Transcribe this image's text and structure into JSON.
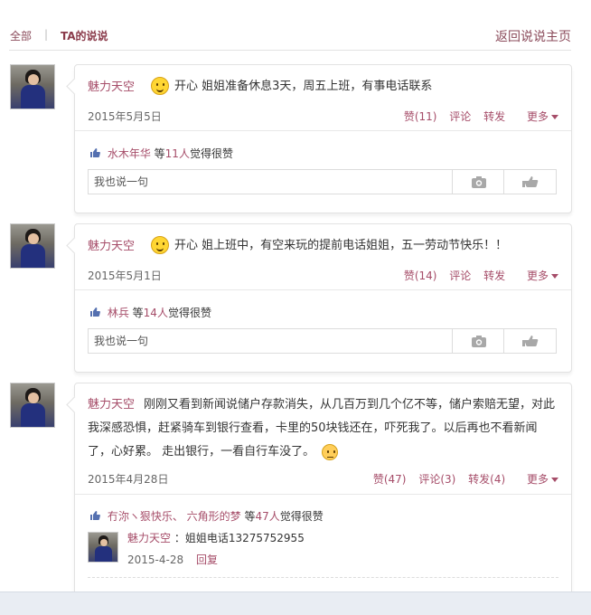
{
  "nav": {
    "all": "全部",
    "separator": "|",
    "current": "TA的说说",
    "back": "返回说说主页"
  },
  "posts": [
    {
      "author": "魅力天空",
      "mood_icon": "smile-emoji",
      "text": "开心 姐姐准备休息3天，周五上班，有事电话联系",
      "date": "2015年5月5日",
      "like_label": "赞(11)",
      "comment_label": "评论",
      "share_label": "转发",
      "more_label": "更多",
      "likers": "水木年华",
      "likes_prefix": " 等",
      "likes_count": "11人",
      "likes_suffix": "觉得很赞",
      "reply_placeholder": "我也说一句"
    },
    {
      "author": "魅力天空",
      "mood_icon": "smile-emoji",
      "text": "开心 姐上班中，有空来玩的提前电话姐姐，五一劳动节快乐！！",
      "date": "2015年5月1日",
      "like_label": "赞(14)",
      "comment_label": "评论",
      "share_label": "转发",
      "more_label": "更多",
      "likers": "林兵",
      "likes_prefix": " 等",
      "likes_count": "14人",
      "likes_suffix": "觉得很赞",
      "reply_placeholder": "我也说一句"
    },
    {
      "author": "魅力天空",
      "text": "刚刚又看到新闻说储户存款消失，从几百万到几个亿不等，储户索赔无望，对此我深感恐惧，赶紧骑车到银行查看，卡里的50块钱还在，吓死我了。以后再也不看新闻了，心好累。 走出银行，一看自行车没了。",
      "date": "2015年4月28日",
      "like_label": "赞(47)",
      "comment_label": "评论(3)",
      "share_label": "转发(4)",
      "more_label": "更多",
      "likers": "冇沵ヽ狠快乐、 六角形的梦",
      "likes_prefix": " 等",
      "likes_count": "47人",
      "likes_suffix": "觉得很赞",
      "comment": {
        "author": "魅力天空",
        "text": "：姐姐电话13275752955",
        "date": "2015-4-28",
        "reply_label": "回复"
      }
    }
  ]
}
